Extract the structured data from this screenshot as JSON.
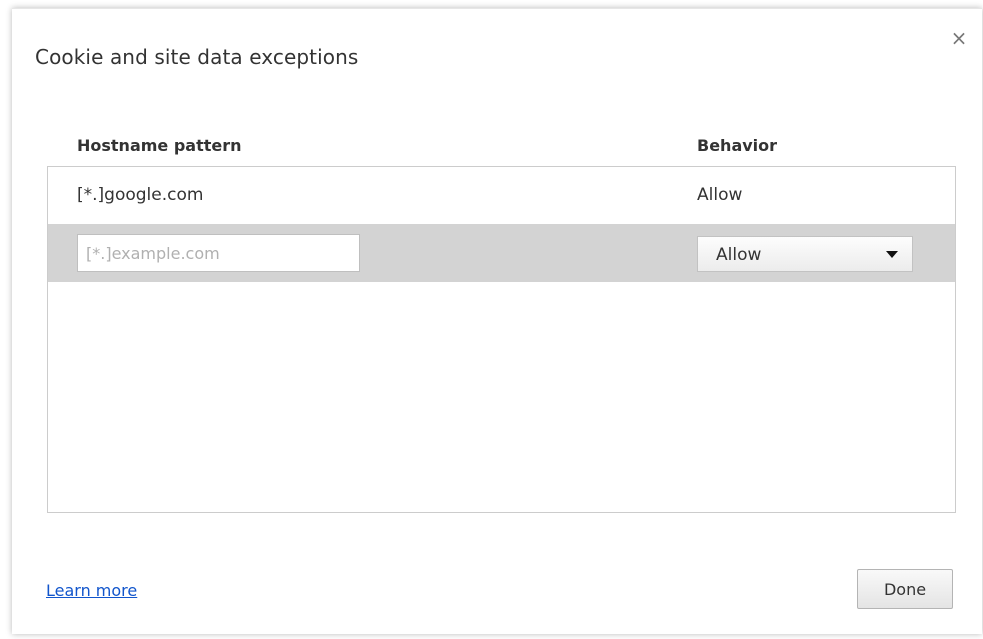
{
  "dialog": {
    "title": "Cookie and site data exceptions",
    "close_glyph": "×",
    "close_icon": "close-icon"
  },
  "table": {
    "headers": {
      "hostname": "Hostname pattern",
      "behavior": "Behavior"
    },
    "rows": [
      {
        "hostname": "[*.]google.com",
        "behavior": "Allow"
      }
    ],
    "new_entry": {
      "hostname_value": "",
      "hostname_placeholder": "[*.]example.com",
      "behavior_selected": "Allow",
      "dropdown_icon": "caret-down-icon"
    }
  },
  "footer": {
    "learn_more": "Learn more",
    "done": "Done"
  },
  "colors": {
    "link": "#1155cc",
    "selected_row": "#d3d3d3",
    "text": "#333333"
  }
}
